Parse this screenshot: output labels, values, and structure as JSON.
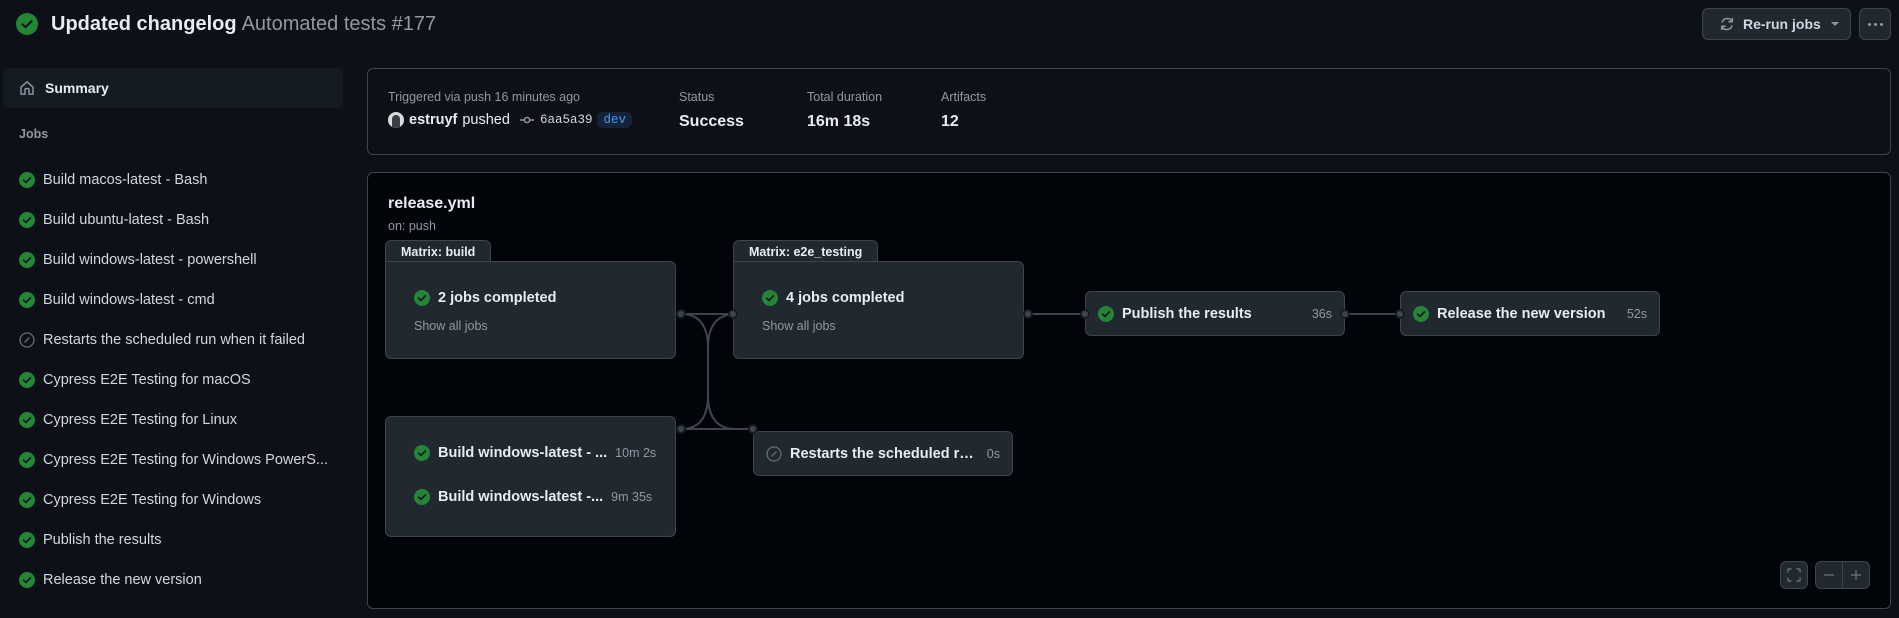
{
  "header": {
    "status_icon": "check-circle-fill-icon",
    "commit_title": "Updated changelog",
    "workflow_run": "Automated tests #177",
    "rerun_label": "Re-run jobs",
    "rerun_icon": "sync-icon",
    "more_icon": "kebab-horizontal-icon"
  },
  "sidebar": {
    "summary_label": "Summary",
    "summary_icon": "home-icon",
    "jobs_heading": "Jobs",
    "jobs": [
      {
        "label": "Build macos-latest - Bash",
        "status": "success"
      },
      {
        "label": "Build ubuntu-latest - Bash",
        "status": "success"
      },
      {
        "label": "Build windows-latest - powershell",
        "status": "success"
      },
      {
        "label": "Build windows-latest - cmd",
        "status": "success"
      },
      {
        "label": "Restarts the scheduled run when it failed",
        "status": "skipped"
      },
      {
        "label": "Cypress E2E Testing for macOS",
        "status": "success"
      },
      {
        "label": "Cypress E2E Testing for Linux",
        "status": "success"
      },
      {
        "label": "Cypress E2E Testing for Windows PowerS...",
        "status": "success"
      },
      {
        "label": "Cypress E2E Testing for Windows",
        "status": "success"
      },
      {
        "label": "Publish the results",
        "status": "success"
      },
      {
        "label": "Release the new version",
        "status": "success"
      }
    ]
  },
  "summary": {
    "trigger_label": "Triggered via push 16 minutes ago",
    "actor": "estruyf",
    "action": "pushed",
    "commit_icon": "git-commit-icon",
    "sha": "6aa5a39",
    "branch": "dev",
    "status_label": "Status",
    "status_value": "Success",
    "duration_label": "Total duration",
    "duration_value": "16m 18s",
    "artifacts_label": "Artifacts",
    "artifacts_value": "12"
  },
  "graph": {
    "workflow_file": "release.yml",
    "trigger": "on: push",
    "matrix_build": {
      "tab": "Matrix: build",
      "summary": "2 jobs completed",
      "show_all": "Show all jobs"
    },
    "matrix_e2e": {
      "tab": "Matrix: e2e_testing",
      "summary": "4 jobs completed",
      "show_all": "Show all jobs"
    },
    "build_group": [
      {
        "label": "Build windows-latest - ...",
        "duration": "10m 2s",
        "status": "success"
      },
      {
        "label": "Build windows-latest -...",
        "duration": "9m 35s",
        "status": "success"
      }
    ],
    "restart_job": {
      "label": "Restarts the scheduled run...",
      "duration": "0s",
      "status": "skipped"
    },
    "publish_job": {
      "label": "Publish the results",
      "duration": "36s",
      "status": "success"
    },
    "release_job": {
      "label": "Release the new version",
      "duration": "52s",
      "status": "success"
    },
    "controls": {
      "fullscreen_icon": "screen-full-icon",
      "zoom_out_icon": "zoom-out-icon",
      "zoom_in_icon": "zoom-in-icon"
    }
  },
  "colors": {
    "success": "#238636",
    "skipped": "#656c76",
    "accent": "#4493f8"
  }
}
